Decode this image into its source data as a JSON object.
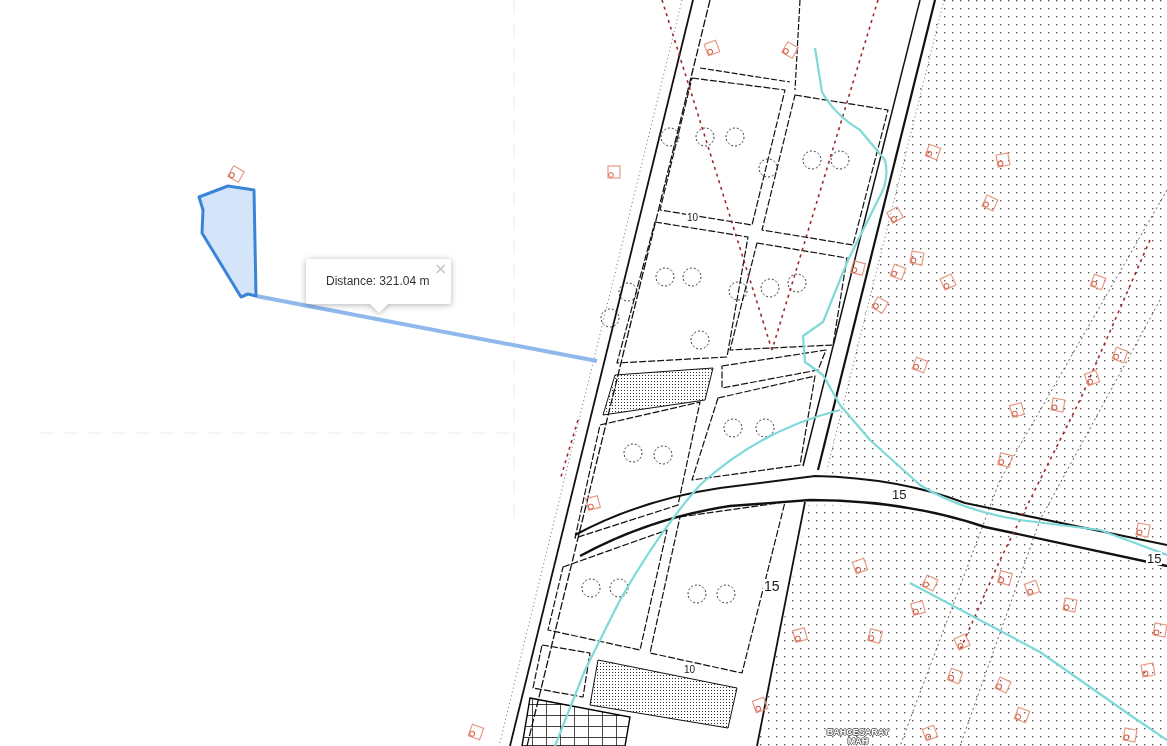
{
  "map": {
    "labels": [
      {
        "text": "15"
      },
      {
        "text": "15"
      },
      {
        "text": "15"
      },
      {
        "text": "10"
      },
      {
        "text": "10"
      }
    ],
    "place_label": "BAHCESARAY MAH"
  },
  "measurement": {
    "popup": {
      "text": "Distance: 321.04 m",
      "close": "×"
    }
  }
}
